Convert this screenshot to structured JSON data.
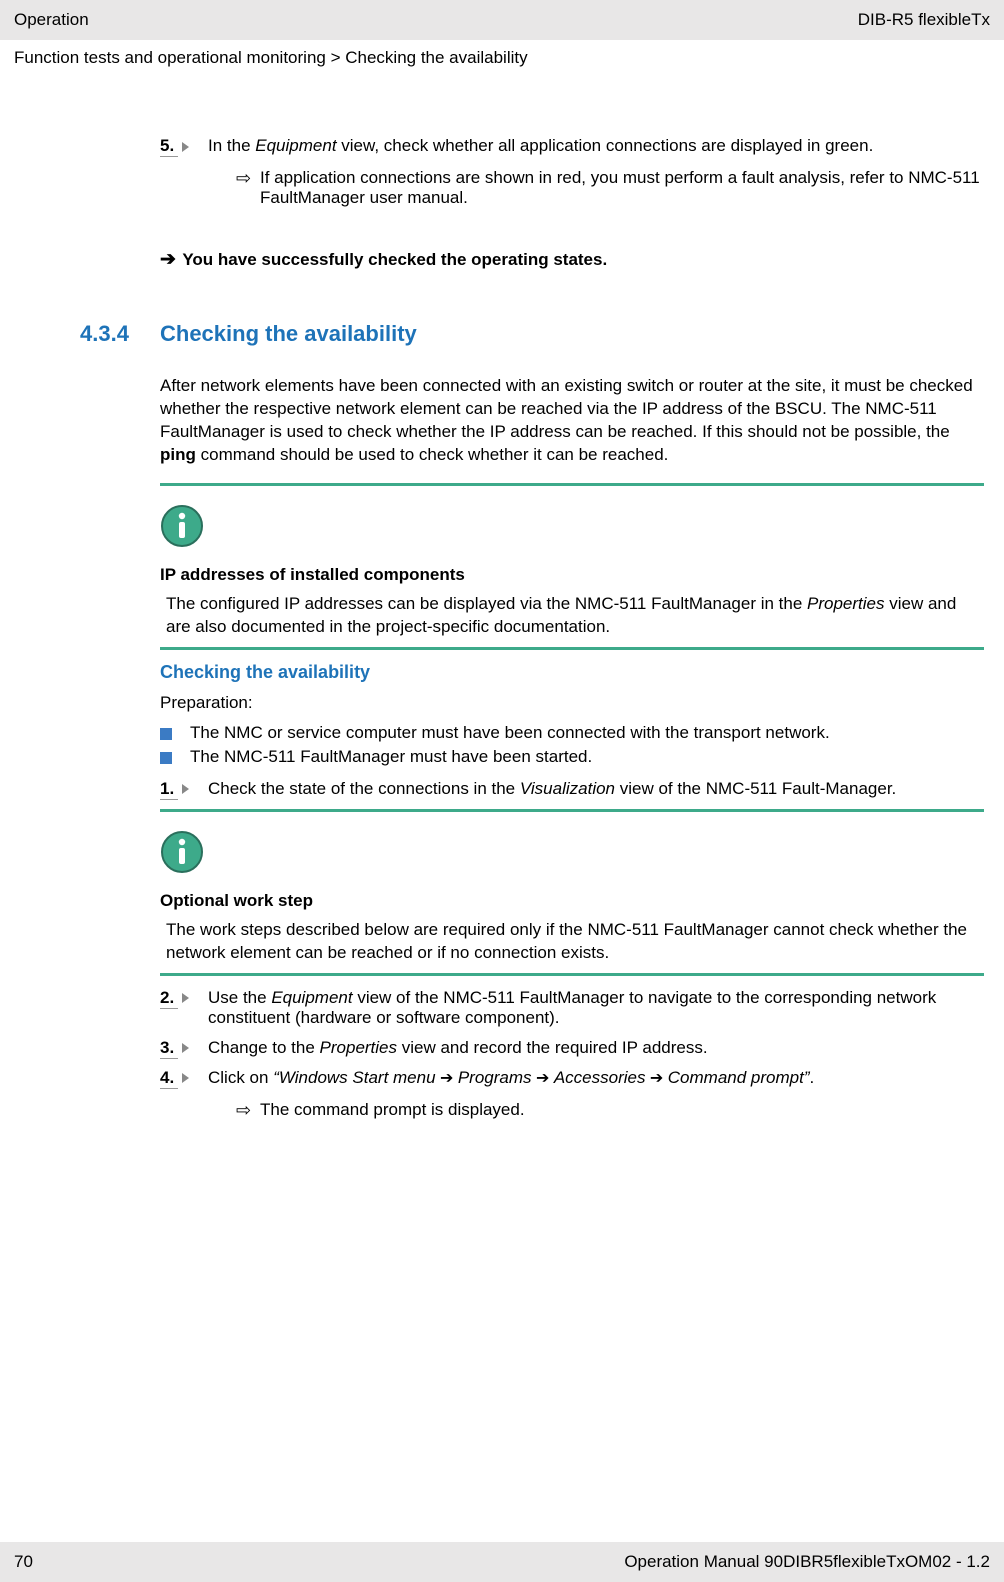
{
  "header": {
    "left": "Operation",
    "right": "DIB-R5 flexibleTx"
  },
  "breadcrumb": "Function tests and operational monitoring > Checking the availability",
  "step5": {
    "num": "5.",
    "text_pre": "In the ",
    "text_em": "Equipment",
    "text_post": " view, check whether all application connections are displayed in green.",
    "sub_text": "If application connections are shown in red, you must perform a fault analysis, refer to NMC-511 FaultManager user manual."
  },
  "result_text": "You have successfully checked the operating states.",
  "section": {
    "num": "4.3.4",
    "title": "Checking the availability"
  },
  "intro_para_pre": "After network elements have been connected with an existing switch or router at the site, it must be checked whether the respective network element can be reached via the IP address of the BSCU. The NMC-511 FaultManager is used to check whether the IP address can be reached. If this should not be possible, the ",
  "intro_para_bold": "ping",
  "intro_para_post": " command should be used to check whether it can be reached.",
  "note1": {
    "title": "IP addresses of installed components",
    "body_pre": "The configured IP addresses can be displayed via the NMC-511 FaultManager in the ",
    "body_em": "Properties",
    "body_post": " view and are also documented in the project-specific documentation."
  },
  "subhead": "Checking the availability",
  "prep_label": "Preparation:",
  "bullets": [
    "The NMC or service computer must have been connected with the transport network.",
    "The NMC-511 FaultManager must have been started."
  ],
  "step1": {
    "num": "1.",
    "pre": "Check the state of the connections in the ",
    "em": "Visualization",
    "post": " view of the NMC-511 Fault-Manager."
  },
  "note2": {
    "title": "Optional work step",
    "body": "The work steps described below are required only if the NMC-511 FaultManager cannot check whether the network element can be reached or if no connection exists."
  },
  "step2": {
    "num": "2.",
    "pre": "Use the ",
    "em": "Equipment",
    "post": " view of the NMC-511 FaultManager to navigate to the corresponding network constituent (hardware or software component)."
  },
  "step3": {
    "num": "3.",
    "pre": "Change to the ",
    "em": "Properties",
    "post": " view and record the required IP address."
  },
  "step4": {
    "num": "4.",
    "pre": "Click on ",
    "q_open": "“",
    "p1": "Windows Start menu",
    "arrow": " ➔ ",
    "p2": "Programs",
    "p3": "Accessories",
    "p4": "Command prompt",
    "q_close": "”",
    "dot": ".",
    "sub": "The command prompt is displayed."
  },
  "footer": {
    "page": "70",
    "right": "Operation Manual 90DIBR5flexibleTxOM02 - 1.2"
  }
}
